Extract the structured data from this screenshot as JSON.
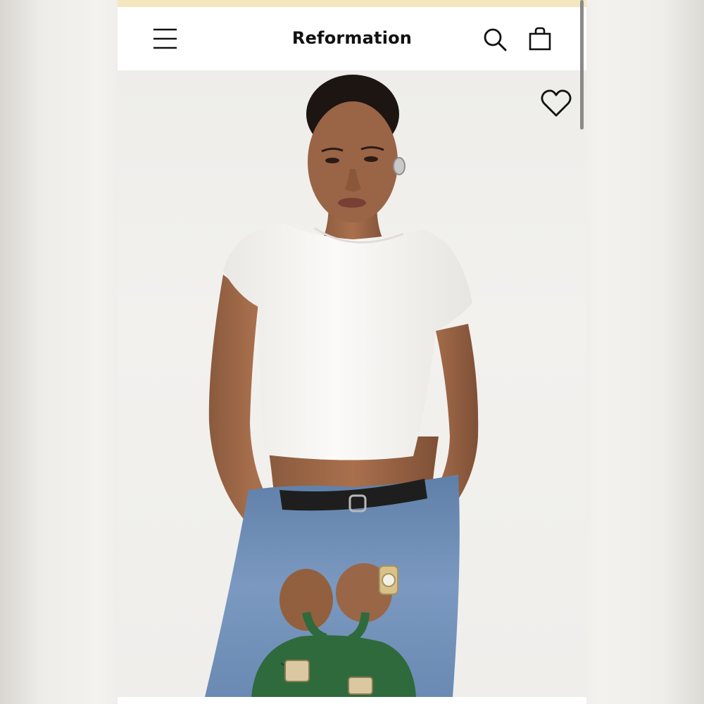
{
  "header": {
    "brand": "Reformation",
    "menu_icon": "hamburger-menu-icon",
    "search_icon": "search-icon",
    "bag_icon": "shopping-bag-icon"
  },
  "product_image": {
    "wishlist_icon": "heart-icon"
  },
  "colors": {
    "promo_strip": "#f4e7bf",
    "header_bg": "#ffffff",
    "brand_text": "#111111",
    "tee": "#f7f6f3",
    "denim": "#6f8fb8",
    "bag": "#2f6a3c",
    "belt": "#1e1e1e"
  }
}
